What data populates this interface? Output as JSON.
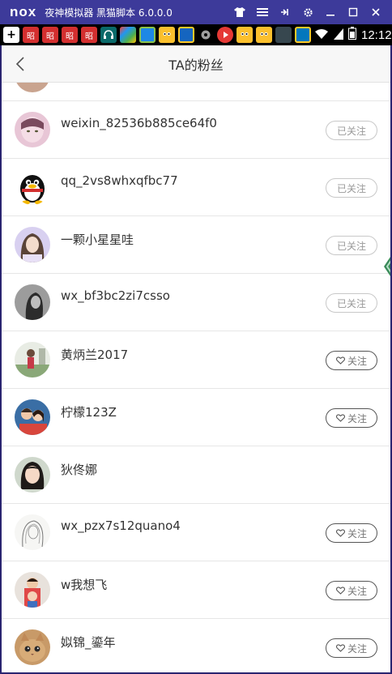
{
  "emulator": {
    "logo": "nox",
    "title": "夜神模拟器 黑猫脚本 6.0.0.0",
    "controls": [
      "shirt-icon",
      "menu-icon",
      "pin-icon",
      "gear-icon",
      "minimize-icon",
      "maximize-icon",
      "close-icon"
    ]
  },
  "status_bar": {
    "time": "12:12",
    "notif_labels": [
      "昭",
      "昭",
      "昭",
      "昭"
    ]
  },
  "header": {
    "title": "TA的粉丝"
  },
  "fans": [
    {
      "name": "weixin_82536b885ce64f0",
      "state": "已关注",
      "avatar": "avatar-pink"
    },
    {
      "name": "qq_2vs8whxqfbc77",
      "state": "已关注",
      "avatar": "avatar-penguin"
    },
    {
      "name": "一颗小星星哇",
      "state": "已关注",
      "avatar": "avatar-girl-lilac"
    },
    {
      "name": "wx_bf3bc2zi7csso",
      "state": "已关注",
      "avatar": "avatar-gray"
    },
    {
      "name": "黄炳兰2017",
      "state": "关注",
      "avatar": "avatar-outdoor"
    },
    {
      "name": "柠檬123Z",
      "state": "关注",
      "avatar": "avatar-couple"
    },
    {
      "name": "狄佟娜",
      "state": "",
      "avatar": "avatar-girl-dark"
    },
    {
      "name": "wx_pzx7s12quano4",
      "state": "关注",
      "avatar": "avatar-sketch"
    },
    {
      "name": "w我想飞",
      "state": "关注",
      "avatar": "avatar-family"
    },
    {
      "name": "姒锦_鎏年",
      "state": "关注",
      "avatar": "avatar-cat"
    }
  ],
  "colors": {
    "emulator_bar": "#3d3a9a",
    "followed_border": "#c8c8c8",
    "follow_border": "#555555",
    "divider": "#e6e6e6"
  }
}
